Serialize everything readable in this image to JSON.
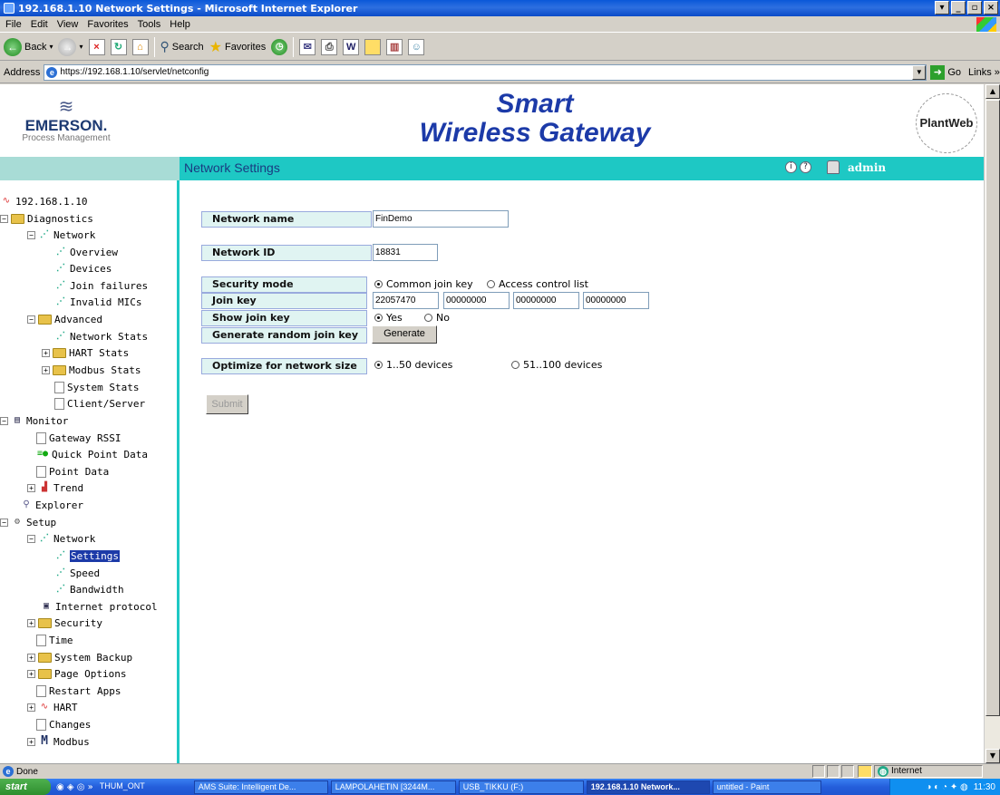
{
  "window": {
    "title": "192.168.1.10 Network Settings - Microsoft Internet Explorer"
  },
  "menu": [
    "File",
    "Edit",
    "View",
    "Favorites",
    "Tools",
    "Help"
  ],
  "toolbar": {
    "back": "Back",
    "search": "Search",
    "favorites": "Favorites"
  },
  "address": {
    "label": "Address",
    "url": "https://192.168.1.10/servlet/netconfig",
    "go": "Go",
    "links": "Links"
  },
  "header": {
    "brand": "EMERSON.",
    "brand_sub": "Process Management",
    "title_line1": "Smart",
    "title_line2": "Wireless Gateway",
    "plantweb": "PlantWeb"
  },
  "nav": {
    "page_title": "Network Settings",
    "user": "admin"
  },
  "tree": {
    "root": "192.168.1.10",
    "diagnostics": "Diagnostics",
    "network": "Network",
    "overview": "Overview",
    "devices": "Devices",
    "join_failures": "Join failures",
    "invalid_mics": "Invalid MICs",
    "advanced": "Advanced",
    "network_stats": "Network Stats",
    "hart_stats": "HART Stats",
    "modbus_stats": "Modbus Stats",
    "system_stats": "System Stats",
    "client_server": "Client/Server",
    "monitor": "Monitor",
    "gateway_rssi": "Gateway RSSI",
    "quick_point_data": "Quick Point Data",
    "point_data": "Point Data",
    "trend": "Trend",
    "explorer": "Explorer",
    "setup": "Setup",
    "setup_network": "Network",
    "settings": "Settings",
    "speed": "Speed",
    "bandwidth": "Bandwidth",
    "internet_protocol": "Internet protocol",
    "security": "Security",
    "time": "Time",
    "system_backup": "System Backup",
    "page_options": "Page Options",
    "restart_apps": "Restart Apps",
    "hart": "HART",
    "changes": "Changes",
    "modbus": "Modbus"
  },
  "form": {
    "network_name_label": "Network name",
    "network_name": "FinDemo",
    "network_id_label": "Network ID",
    "network_id": "18831",
    "security_mode_label": "Security mode",
    "security_mode_options": [
      "Common join key",
      "Access control list"
    ],
    "security_mode_selected": "Common join key",
    "join_key_label": "Join key",
    "join_key": [
      "22057470",
      "00000000",
      "00000000",
      "00000000"
    ],
    "show_join_key_label": "Show join key",
    "show_join_key_options": [
      "Yes",
      "No"
    ],
    "show_join_key_selected": "Yes",
    "generate_label": "Generate random join key",
    "generate_button": "Generate",
    "optimize_label": "Optimize for network size",
    "optimize_options": [
      "1..50 devices",
      "51..100 devices"
    ],
    "optimize_selected": "1..50 devices",
    "submit_button": "Submit"
  },
  "status": {
    "text": "Done",
    "zone": "Internet"
  },
  "taskbar": {
    "start": "start",
    "quicklaunch_folder": "THUM_ONT",
    "tasks": [
      "AMS Suite: Intelligent De...",
      "LAMPOLAHETIN [3244M...",
      "USB_TIKKU (F:)",
      "192.168.1.10 Network...",
      "untitled - Paint"
    ],
    "clock": "11:30"
  }
}
